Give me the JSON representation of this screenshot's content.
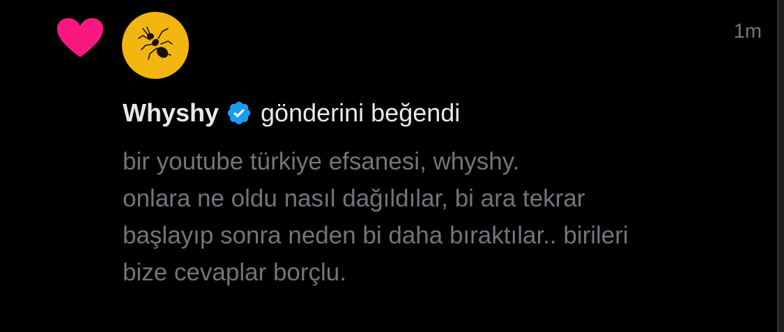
{
  "notification": {
    "type_icon": "heart-icon",
    "avatar_icon": "ant-icon",
    "timestamp": "1m",
    "username": "Whyshy",
    "verified_icon": "verified-badge-icon",
    "action_text": "gönderini beğendi",
    "post_lines": [
      "bir youtube türkiye efsanesi, whyshy.",
      "onlara ne oldu nasıl dağıldılar, bi ara tekrar",
      "başlayıp sonra neden bi daha bıraktılar.. birileri",
      "bize cevaplar borçlu."
    ]
  },
  "colors": {
    "background": "#000000",
    "heart": "#f91880",
    "avatar_bg": "#f3b510",
    "verified": "#1d9bf0",
    "primary_text": "#e7e9ea",
    "secondary_text": "#71767b"
  }
}
